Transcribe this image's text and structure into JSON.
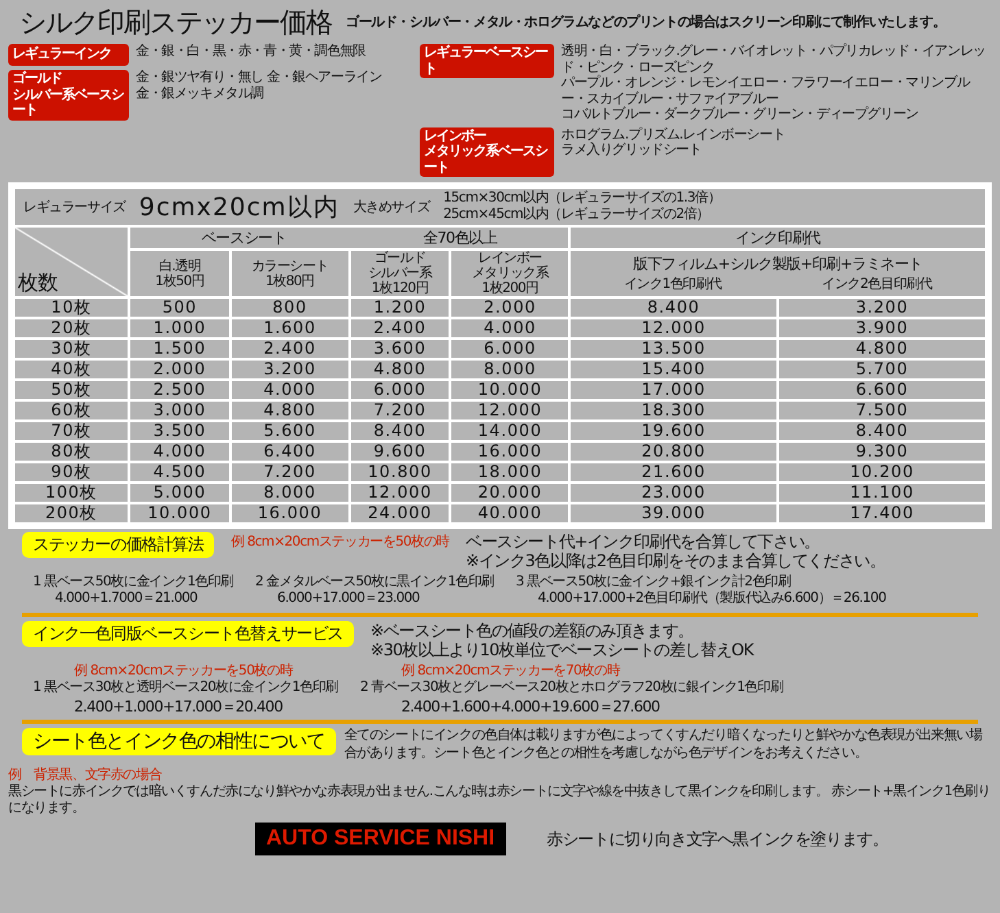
{
  "header": {
    "title": "シルク印刷ステッカー価格",
    "subtitle": "ゴールド・シルバー・メタル・ホログラムなどのプリントの場合はスクリーン印刷にて制作いたします。"
  },
  "legend_left": [
    {
      "badge": [
        "レギュラーインク"
      ],
      "lines": [
        "金・銀・白・黒・赤・青・黄・調色無限"
      ]
    },
    {
      "badge": [
        "ゴールド",
        "シルバー系ベースシート"
      ],
      "lines": [
        "金・銀ツヤ有り・無し 金・銀ヘアーライン",
        "金・銀メッキメタル調"
      ]
    }
  ],
  "legend_right": [
    {
      "badge": [
        "レギュラーベースシート"
      ],
      "lines": [
        "透明・白・ブラック.グレー・バイオレット・パプリカレッド・イアンレッド・ピンク・ローズピンク",
        "パープル・オレンジ・レモンイエロー・フラワーイエロー・マリンブルー・スカイブルー・サファイアブルー",
        "コバルトブルー・ダークブルー・グリーン・ディープグリーン"
      ]
    },
    {
      "badge": [
        "レインボー",
        "メタリック系ベースシート"
      ],
      "lines": [
        "ホログラム.プリズム.レインボーシート",
        "ラメ入りグリッドシート"
      ]
    }
  ],
  "price_table": {
    "regular_label": "レギュラーサイズ",
    "regular_size": "9cmx20cm以内",
    "large_label": "大きめサイズ",
    "large_sizes": [
      "15cm×30cm以内（レギュラーサイズの1.3倍）",
      "25cm×45cm以内（レギュラーサイズの2倍）"
    ],
    "count_header": "枚数",
    "base_header": "ベースシート",
    "base_note": "全70色以上",
    "ink_header": "インク印刷代",
    "base_columns": [
      {
        "lines": [
          "白.透明",
          "1枚50円"
        ]
      },
      {
        "lines": [
          "カラーシート",
          "1枚80円"
        ]
      },
      {
        "lines": [
          "ゴールド",
          "シルバー系",
          "1枚120円"
        ]
      },
      {
        "lines": [
          "レインボー",
          "メタリック系",
          "1枚200円"
        ]
      }
    ],
    "ink_process": "版下フィルム+シルク製版+印刷+ラミネート",
    "ink_columns": [
      "インク1色印刷代",
      "インク2色目印刷代"
    ],
    "rows": [
      {
        "count": "10枚",
        "cells": [
          "500",
          "800",
          "1.200",
          "2.000",
          "8.400",
          "3.200"
        ]
      },
      {
        "count": "20枚",
        "cells": [
          "1.000",
          "1.600",
          "2.400",
          "4.000",
          "12.000",
          "3.900"
        ]
      },
      {
        "count": "30枚",
        "cells": [
          "1.500",
          "2.400",
          "3.600",
          "6.000",
          "13.500",
          "4.800"
        ]
      },
      {
        "count": "40枚",
        "cells": [
          "2.000",
          "3.200",
          "4.800",
          "8.000",
          "15.400",
          "5.700"
        ]
      },
      {
        "count": "50枚",
        "cells": [
          "2.500",
          "4.000",
          "6.000",
          "10.000",
          "17.000",
          "6.600"
        ]
      },
      {
        "count": "60枚",
        "cells": [
          "3.000",
          "4.800",
          "7.200",
          "12.000",
          "18.300",
          "7.500"
        ]
      },
      {
        "count": "70枚",
        "cells": [
          "3.500",
          "5.600",
          "8.400",
          "14.000",
          "19.600",
          "8.400"
        ]
      },
      {
        "count": "80枚",
        "cells": [
          "4.000",
          "6.400",
          "9.600",
          "16.000",
          "20.800",
          "9.300"
        ]
      },
      {
        "count": "90枚",
        "cells": [
          "4.500",
          "7.200",
          "10.800",
          "18.000",
          "21.600",
          "10.200"
        ]
      },
      {
        "count": "100枚",
        "cells": [
          "5.000",
          "8.000",
          "12.000",
          "20.000",
          "23.000",
          "11.100"
        ]
      },
      {
        "count": "200枚",
        "cells": [
          "10.000",
          "16.000",
          "24.000",
          "40.000",
          "39.000",
          "17.400"
        ]
      }
    ]
  },
  "calculation": {
    "label": "ステッカーの価格計算法",
    "example": "例 8cm×20cmステッカーを50枚の時",
    "notes": [
      "ベースシート代+インク印刷代を合算して下さい。",
      "※インク3色以降は2色目印刷をそのまま合算してください。"
    ],
    "cases": [
      {
        "title": "1 黒ベース50枚に金インク1色印刷",
        "formula": "4.000+1.7000＝21.000"
      },
      {
        "title": "2 金メタルベース50枚に黒インク1色印刷",
        "formula": "6.000+17.000＝23.000"
      },
      {
        "title": "3 黒ベース50枚に金インク+銀インク計2色印刷",
        "formula": "4.000+17.000+2色目印刷代（製版代込み6.600）＝26.100"
      }
    ]
  },
  "service": {
    "label": "インク一色同版ベースシート色替えサービス",
    "notes": [
      "※ベースシート色の値段の差額のみ頂きます。",
      "※30枚以上より10枚単位でベースシートの差し替えOK"
    ],
    "cases": [
      {
        "example": "例 8cm×20cmステッカーを50枚の時",
        "title": "1 黒ベース30枚と透明ベース20枚に金インク1色印刷",
        "formula": "2.400+1.000+17.000＝20.400"
      },
      {
        "example": "例 8cm×20cmステッカーを70枚の時",
        "title": "2 青ベース30枚とグレーベース20枚とホログラフ20枚に銀インク1色印刷",
        "formula": "2.400+1.600+4.000+19.600＝27.600"
      }
    ]
  },
  "compatibility": {
    "label": "シート色とインク色の相性について",
    "text": "全てのシートにインクの色自体は載りますが色によってくすんだり暗くなったりと鮮やかな色表現が出来無い場合があります。シート色とインク色との相性を考慮しながら色デザインをお考えください。"
  },
  "sample": {
    "example": "例　背景黒、文字赤の場合",
    "text": "黒シートに赤インクでは暗いくすんだ赤になり鮮やかな赤表現が出ません.こんな時は赤シートに文字や線を中抜きして黒インクを印刷します。 赤シート+黒インク1色刷りになります。",
    "logo": "AUTO SERVICE NISHI",
    "caption": "赤シートに切り向き文字へ黒インクを塗ります。"
  }
}
